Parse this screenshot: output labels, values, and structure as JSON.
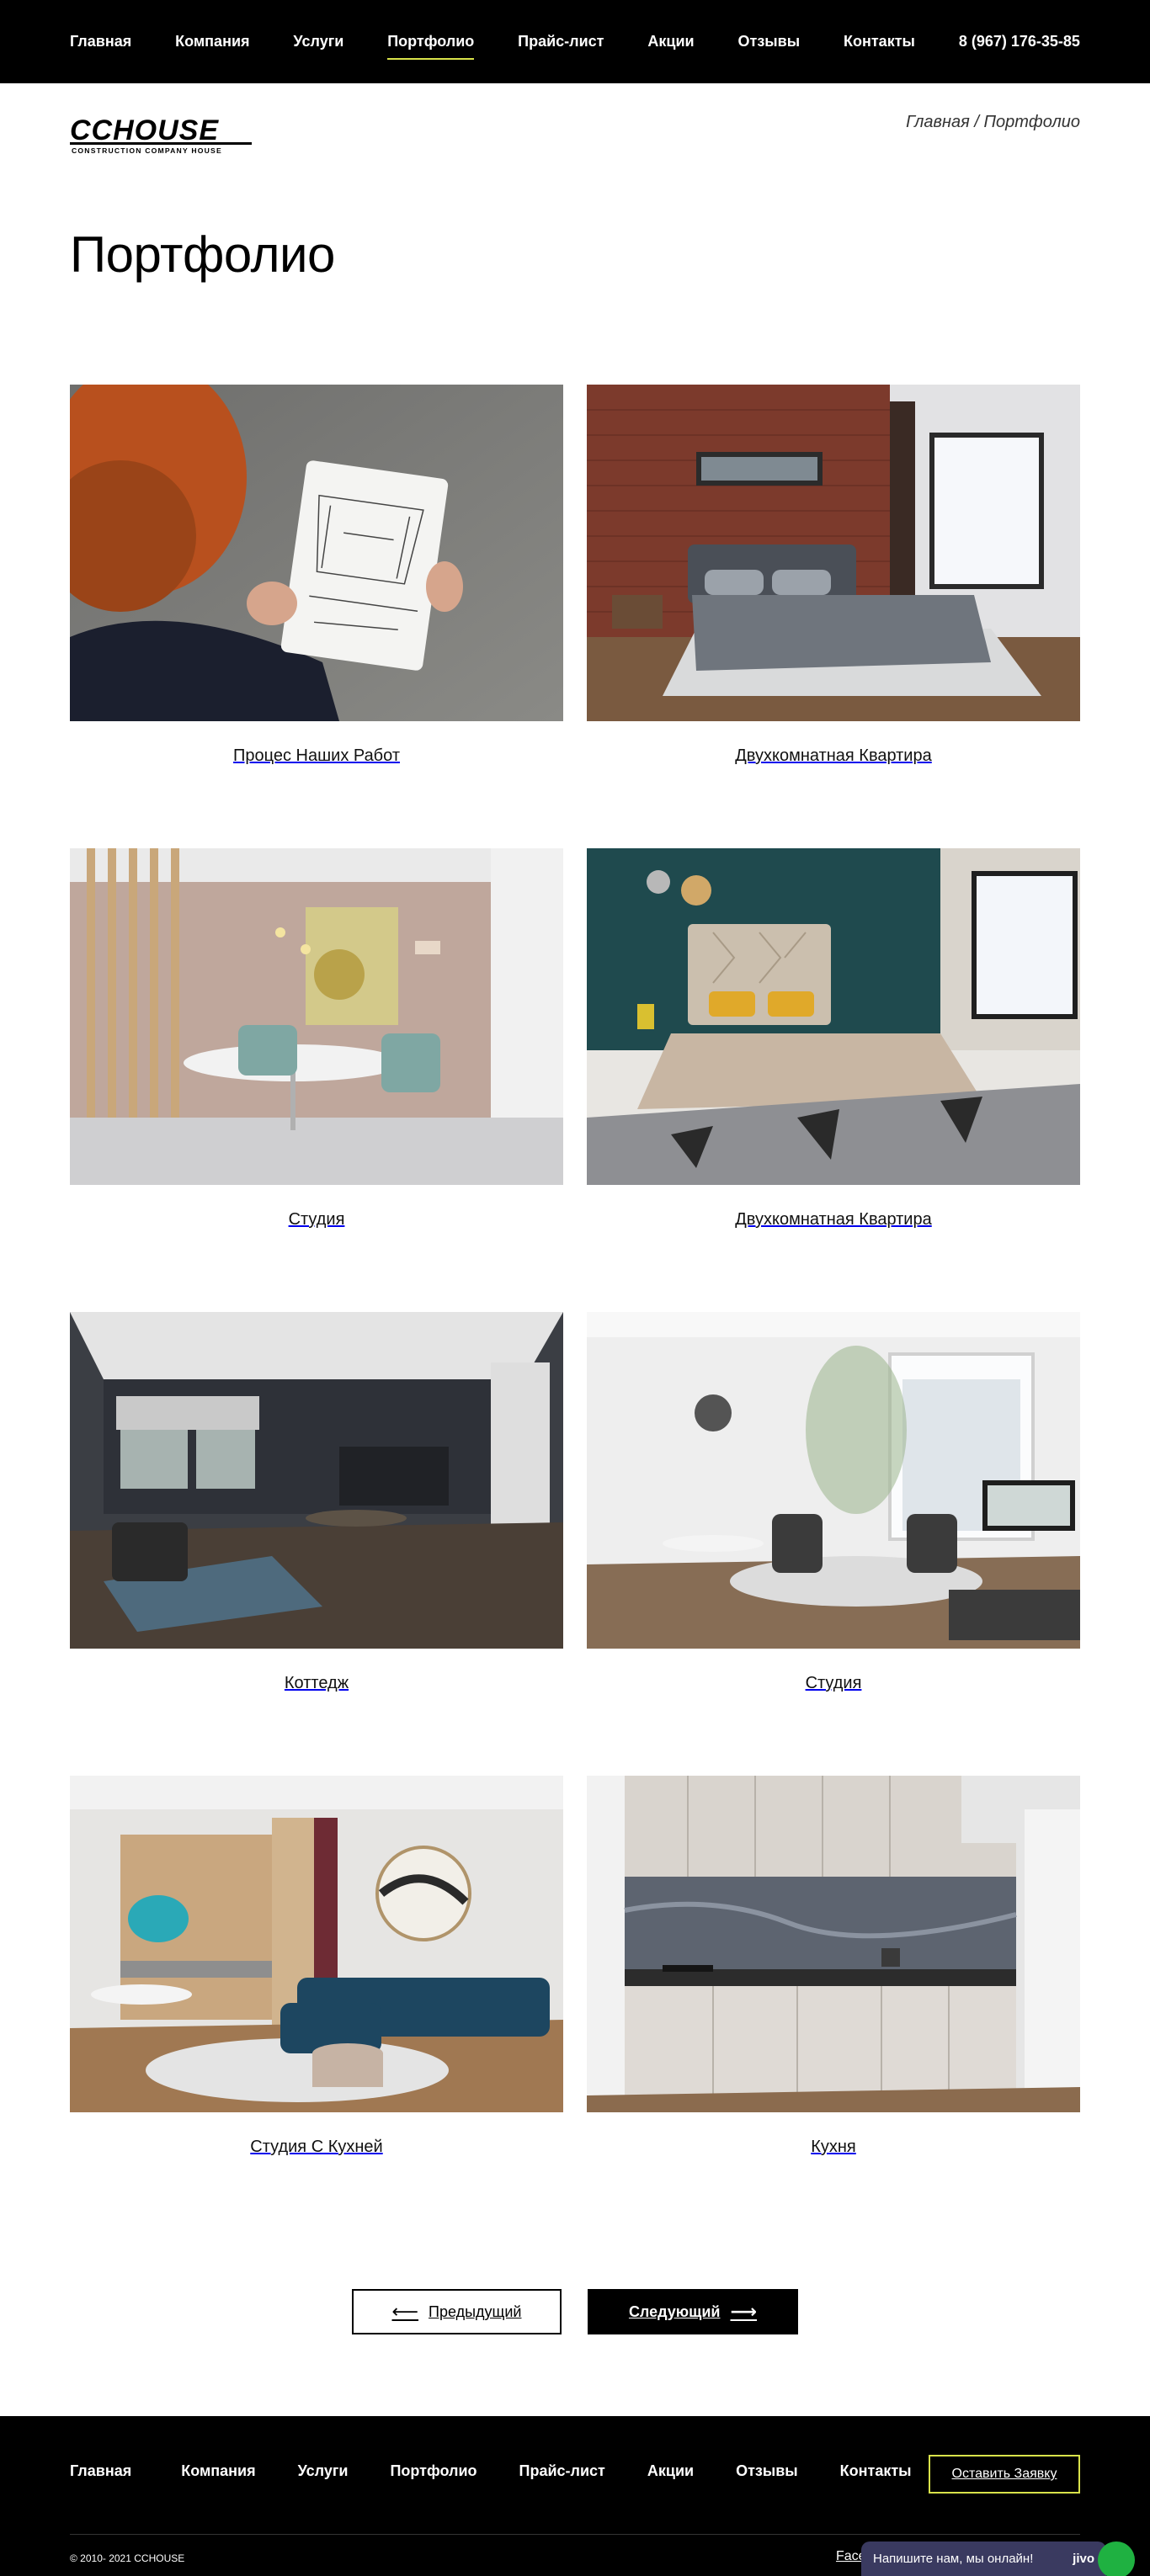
{
  "nav": {
    "items": [
      "Главная",
      "Компания",
      "Услуги",
      "Портфолио",
      "Прайс-лист",
      "Акции",
      "Отзывы",
      "Контакты"
    ],
    "active_index": 3,
    "phone": "8 (967) 176-35-85"
  },
  "logo": {
    "title": "CCHOUSE",
    "subtitle": "CONSTRUCTION COMPANY HOUSE"
  },
  "breadcrumb": {
    "home": "Главная",
    "sep": " / ",
    "current": "Портфолио"
  },
  "page": {
    "title": "Портфолио"
  },
  "portfolio": [
    {
      "caption": "Процес Наших Работ",
      "scene": "sketch"
    },
    {
      "caption": "Двухкомнатная Квартира",
      "scene": "brick-bedroom"
    },
    {
      "caption": "Студия",
      "scene": "dining"
    },
    {
      "caption": "Двухкомнатная Квартира",
      "scene": "teal-bedroom"
    },
    {
      "caption": "Коттедж",
      "scene": "cottage"
    },
    {
      "caption": "Студия",
      "scene": "studio-light"
    },
    {
      "caption": "Студия С Кухней",
      "scene": "blue-sofa"
    },
    {
      "caption": "Кухня",
      "scene": "kitchen"
    }
  ],
  "pager": {
    "prev": "Предыдущий",
    "next": "Следующий"
  },
  "footer": {
    "items": [
      "Главная",
      "Компания",
      "Услуги",
      "Портфолио",
      "Прайс-лист",
      "Акции",
      "Отзывы",
      "Контакты"
    ],
    "order": "Оставить Заявку",
    "copyright": "© 2010- 2021 CCHOUSE",
    "facebook": "Face",
    "chat": "Напишите нам, мы онлайн!",
    "chat_brand": "jivo"
  },
  "colors": {
    "accent": "#d8e24a",
    "dark": "#000000",
    "chat": "#3a3a60",
    "chat_dot": "#1fb141"
  }
}
